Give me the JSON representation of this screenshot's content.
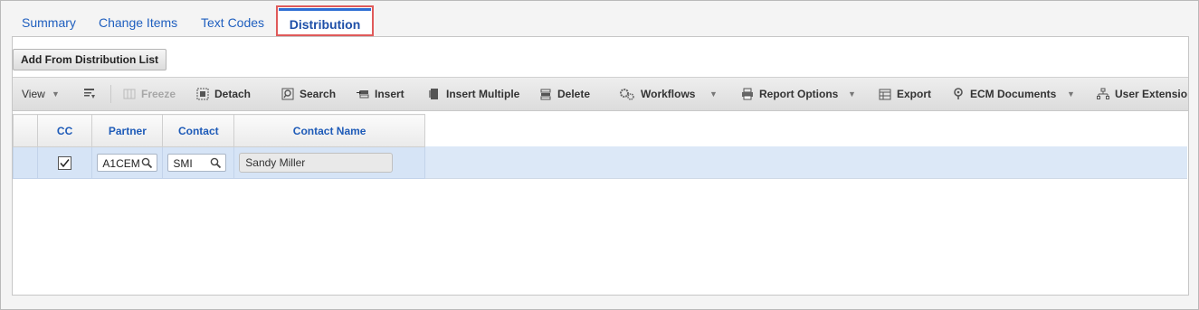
{
  "tabs": [
    {
      "label": "Summary"
    },
    {
      "label": "Change Items"
    },
    {
      "label": "Text Codes"
    },
    {
      "label": "Distribution",
      "active": true
    }
  ],
  "actions": {
    "add_from_distribution_list": "Add From Distribution List"
  },
  "toolbar": {
    "view": "View",
    "freeze": "Freeze",
    "detach": "Detach",
    "search": "Search",
    "insert": "Insert",
    "insert_multiple": "Insert Multiple",
    "delete": "Delete",
    "workflows": "Workflows",
    "report_options": "Report Options",
    "export": "Export",
    "ecm_documents": "ECM Documents",
    "user_extensions": "User Extensio"
  },
  "grid": {
    "columns": [
      "CC",
      "Partner",
      "Contact",
      "Contact Name"
    ],
    "rows": [
      {
        "cc": true,
        "partner": "A1CEM",
        "contact": "SMI",
        "contact_name": "Sandy Miller"
      }
    ]
  },
  "colors": {
    "accent": "#1f5fbf",
    "highlight_border": "#e05a5a",
    "selected_row": "#d6e4f6"
  }
}
